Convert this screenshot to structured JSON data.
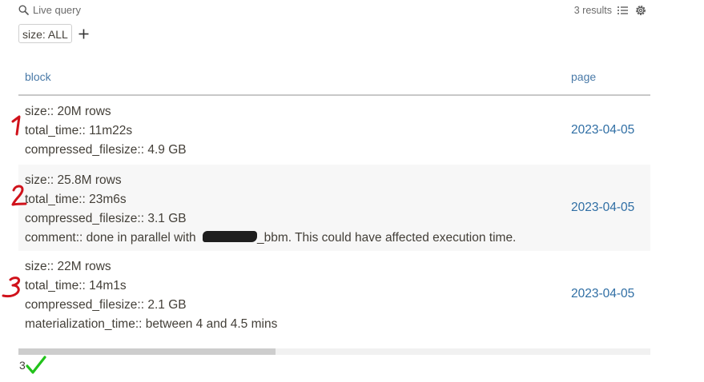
{
  "query": {
    "title": "Live query",
    "results_label": "3 results",
    "icons": [
      "search-icon",
      "list-icon",
      "gear-icon",
      "plus-icon"
    ],
    "filter_chip": "size: ALL"
  },
  "table": {
    "columns": [
      "block",
      "page"
    ],
    "rows": [
      {
        "lines": [
          "size:: 20M rows",
          "total_time:: 11m22s",
          "compressed_filesize:: 4.9 GB"
        ],
        "page": "2023-04-05"
      },
      {
        "lines": [
          "size:: 25.8M rows",
          "total_time:: 23m6s",
          "compressed_filesize:: 3.1 GB"
        ],
        "comment_prefix": "comment:: done in parallel with ",
        "comment_suffix": "_bbm. This could have affected execution time.",
        "page": "2023-04-05"
      },
      {
        "lines": [
          "size:: 22M rows",
          "total_time:: 14m1s",
          "compressed_filesize:: 2.1 GB",
          "materialization_time:: between 4 and 4.5 mins"
        ],
        "page": "2023-04-05"
      }
    ]
  },
  "footer": {
    "count": "3"
  },
  "annotation_color": "#d0121b",
  "check_color": "#21c21a",
  "link_color": "#2f6ea4"
}
